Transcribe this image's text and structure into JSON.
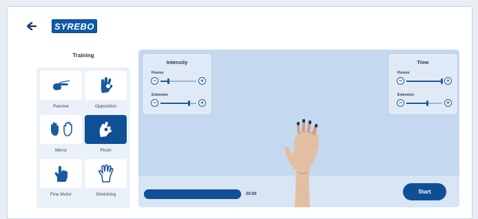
{
  "app": {
    "logo_text": "SYREBO"
  },
  "training": {
    "title": "Training",
    "items": [
      {
        "label": "Passive",
        "icon": "passive-hand-icon",
        "active": false
      },
      {
        "label": "Opposition",
        "icon": "opposition-hand-icon",
        "active": false
      },
      {
        "label": "Mirror",
        "icon": "mirror-hands-icon",
        "active": false
      },
      {
        "label": "Pinch",
        "icon": "pinch-hand-icon",
        "active": true
      },
      {
        "label": "Fine Motor",
        "icon": "fine-motor-hand-icon",
        "active": false
      },
      {
        "label": "Stretching",
        "icon": "stretching-hand-icon",
        "active": false
      }
    ]
  },
  "intensity": {
    "title": "Intensity",
    "flexion_label": "Flexion",
    "extension_label": "Extension",
    "flexion_level": 0.22,
    "extension_level": 0.78
  },
  "time": {
    "title": "Time",
    "flexion_label": "Flexion",
    "extension_label": "Extension",
    "flexion_level": 0.98,
    "extension_level": 0.58
  },
  "session": {
    "time_label": "20:00",
    "progress": 1.0,
    "start_label": "Start"
  },
  "colors": {
    "primary": "#0f4f96",
    "stage_bg": "#c4d9ef",
    "panel_bg": "#eaf1f9"
  }
}
